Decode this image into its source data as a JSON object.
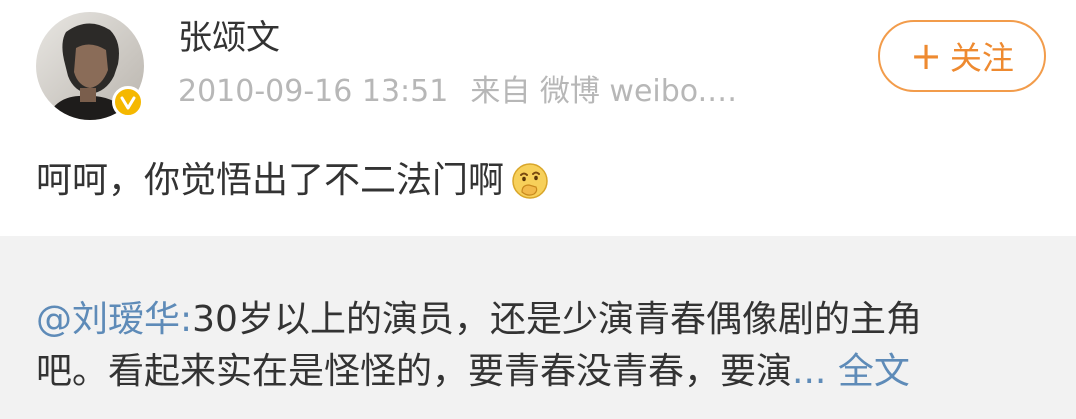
{
  "user": {
    "name": "张颂文",
    "verified": true,
    "badge_color": "#f5b800"
  },
  "meta": {
    "timestamp": "2010-09-16 13:51",
    "source": "来自 微博 weibo.…"
  },
  "follow_button": {
    "icon": "+",
    "label": "关注",
    "color": "#ee8a30"
  },
  "post": {
    "text": "呵呵，你觉悟出了不二法门啊",
    "emoji": "thinking-face-icon"
  },
  "repost": {
    "mention": "@刘瑷华:",
    "line1_text": "30岁以上的演员，还是少演青春偶像剧的主角",
    "line2_text": "吧。看起来实在是怪怪的，要青春没青春，要演",
    "ellipsis": "...",
    "expand_label": "全文",
    "link_color": "#5e8bb8",
    "background": "#f2f2f2"
  }
}
